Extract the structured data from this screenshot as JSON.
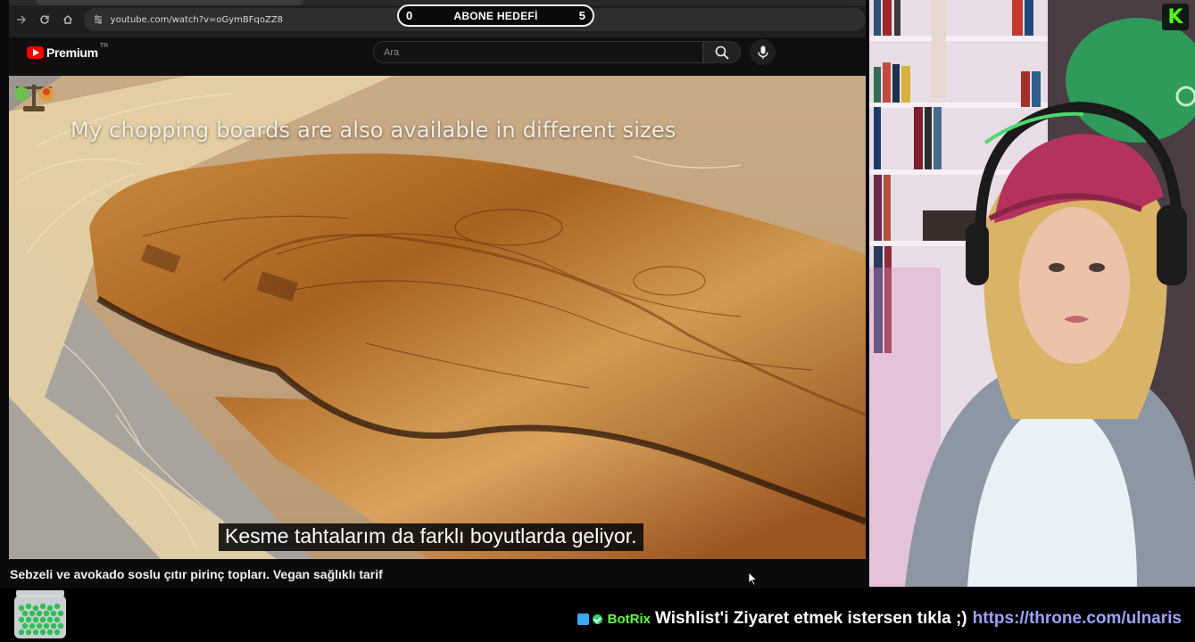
{
  "browser": {
    "url": "youtube.com/watch?v=oGymBFqoZZ8",
    "back_icon": "arrow-right-icon",
    "reload_icon": "reload-icon",
    "home_icon": "home-icon"
  },
  "sub_goal": {
    "current": "0",
    "label": "ABONE HEDEFİ",
    "target": "5"
  },
  "youtube": {
    "brand": "Premium",
    "region": "TR",
    "search_placeholder": "Ara",
    "search_icon": "search-icon",
    "mic_icon": "mic-icon"
  },
  "video": {
    "burned_caption": "My chopping boards are also available in different sizes",
    "subtitle": "Kesme tahtalarım da farklı boyutlarda geliyor.",
    "title": "Sebzeli ve avokado soslu çıtır pirinç topları. Vegan sağlıklı tarif"
  },
  "overlay": {
    "kick_letter": "K",
    "chat_user": "BotRix",
    "chat_message": "Wishlist'i Ziyaret etmek istersen tıkla ;)",
    "chat_link": "https://throne.com/ulnaris"
  },
  "colors": {
    "kick_green": "#53fc18",
    "youtube_red": "#ff0000",
    "botrix_green": "#5cff42",
    "link_blue": "#9aa4ff"
  }
}
